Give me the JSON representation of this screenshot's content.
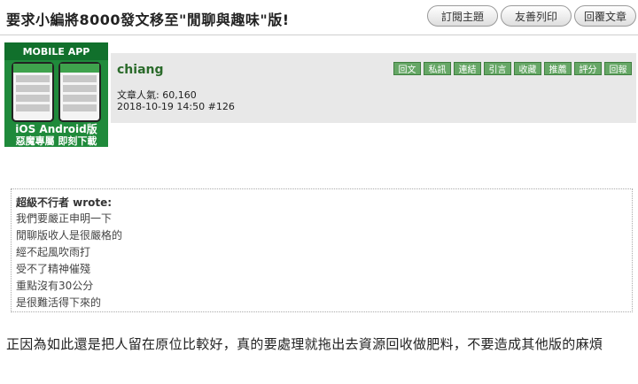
{
  "thread": {
    "title": "要求小編將8000發文移至\"閒聊與趣味\"版!",
    "buttons": [
      "訂閱主題",
      "友善列印",
      "回覆文章"
    ]
  },
  "banner": {
    "top": "MOBILE APP",
    "line1": "iOS Android版",
    "line2": "惡魔專屬 即刻下載"
  },
  "post": {
    "author": "chiang",
    "popularity": "文章人氣: 60,160",
    "datetime_floor": "2018-10-19 14:50  #126",
    "actions": [
      "回文",
      "私訊",
      "連結",
      "引言",
      "收藏",
      "推薦",
      "評分",
      "回報"
    ]
  },
  "quote": {
    "author": "超級不行者 wrote:",
    "lines": [
      "我們要嚴正申明一下",
      "閒聊版收人是很嚴格的",
      "經不起風吹雨打",
      "受不了精神催殘",
      "重點沒有30公分",
      "是很難活得下來的"
    ]
  },
  "body": "正因為如此還是把人留在原位比較好，真的要處理就拖出去資源回收做肥料，不要造成其他版的麻煩"
}
